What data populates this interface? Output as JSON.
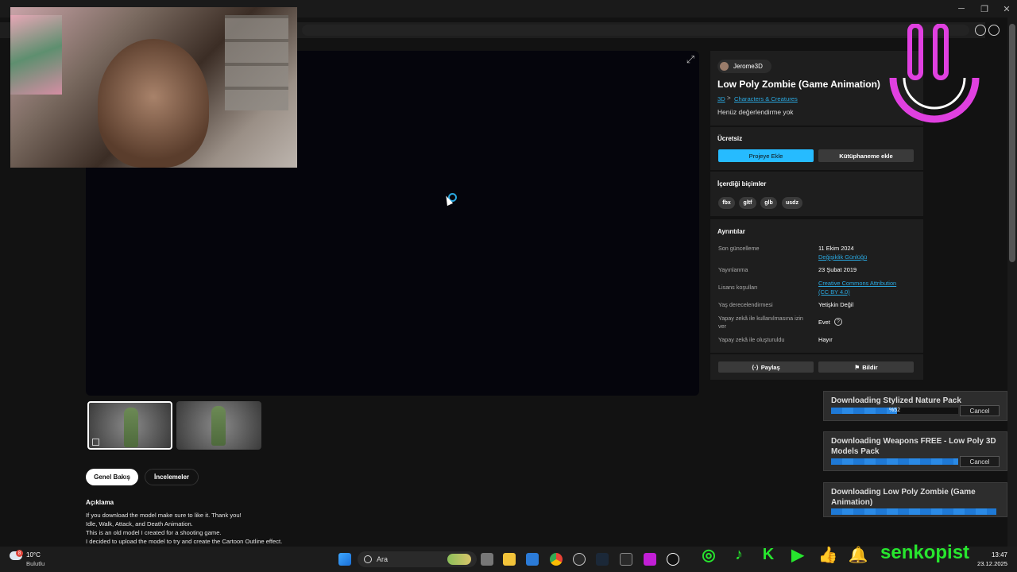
{
  "window": {
    "minimize": "─",
    "maximize": "❐",
    "close": "✕"
  },
  "product": {
    "author": "Jerome3D",
    "title": "Low Poly Zombie (Game Animation)",
    "breadcrumb": [
      "3D",
      "Characters & Creatures"
    ],
    "breadcrumb_sep": ">",
    "rating": "Henüz değerlendirme yok",
    "price": "Ücretsiz",
    "add_to_project": "Projeye Ekle",
    "add_to_library": "Kütüphaneme ekle",
    "formats_heading": "İçerdiği biçimler",
    "formats": [
      "fbx",
      "gltf",
      "glb",
      "usdz"
    ],
    "details_heading": "Ayrıntılar",
    "details": {
      "last_update_label": "Son güncelleme",
      "last_update_value": "11 Ekim 2024",
      "changelog_link": "Değişiklik Günlüğü",
      "published_label": "Yayınlanma",
      "published_value": "23 Şubat 2019",
      "license_label": "Lisans koşulları",
      "license_value_1": "Creative Commons Attribution",
      "license_value_2": "(CC BY 4.0)",
      "age_label": "Yaş derecelendirmesi",
      "age_value": "Yetişkin Değil",
      "ai_use_label_1": "Yapay zekâ ile kullanılmasına izin",
      "ai_use_label_2": "ver",
      "ai_use_value": "Evet",
      "ai_made_label": "Yapay zekâ ile oluşturuldu",
      "ai_made_value": "Hayır"
    },
    "share": "Paylaş",
    "report": "Bildir"
  },
  "tabs": [
    "Genel Bakış",
    "İncelemeler"
  ],
  "description": {
    "title": "Açıklama",
    "lines": [
      "If you download the model make sure to like it. Thank you!",
      "Idle, Walk, Attack, and Death Animation.",
      "This is an old model I created for a shooting game.",
      "I decided to upload the model to try and create the Cartoon Outline effect."
    ]
  },
  "downloads": [
    {
      "title": "Downloading Stylized Nature Pack",
      "progress": 0.52,
      "percent_text": "%52",
      "cancel": "Cancel"
    },
    {
      "title_1": "Downloading Weapons FREE - Low Poly 3D",
      "title_2": "Models Pack",
      "progress": 1.0,
      "cancel": "Cancel"
    },
    {
      "title_1": "Downloading Low Poly Zombie (Game",
      "title_2": "Animation)",
      "progress": 1.0
    }
  ],
  "taskbar": {
    "weather_temp": "10°C",
    "weather_desc": "Bulutlu",
    "weather_badge": "8",
    "search_placeholder": "Ara",
    "time": "13:47",
    "date": "23.12.2025"
  },
  "overlay": {
    "channel": "senkopist",
    "social_icons": [
      "instagram-icon",
      "tiktok-icon",
      "kick-icon",
      "youtube-icon",
      "thumbs-up-icon",
      "bell-icon"
    ]
  },
  "colors": {
    "accent": "#26bbff",
    "link": "#2aa8e0",
    "social": "#27e62e",
    "logo": "#e040e0"
  }
}
